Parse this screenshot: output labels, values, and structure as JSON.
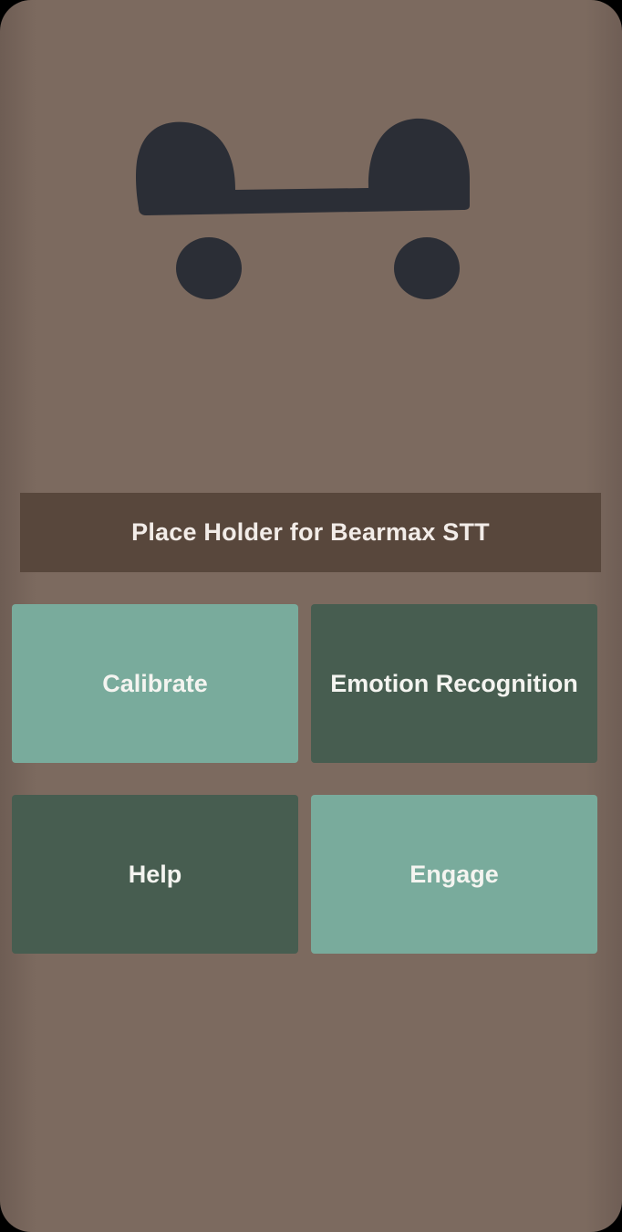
{
  "colors": {
    "background": "#7c6a5f",
    "face_features": "#2b2e36",
    "stt_bar": "#58473c",
    "button_light": "#79ab9c",
    "button_dark": "#475d50",
    "text": "#f4f4f0"
  },
  "face": {
    "eyebrows": "eyebrows-icon",
    "left_eye": "eye-icon",
    "right_eye": "eye-icon"
  },
  "stt": {
    "text": "Place Holder for Bearmax STT"
  },
  "buttons": {
    "calibrate": "Calibrate",
    "emotion_recognition": "Emotion Recognition",
    "help": "Help",
    "engage": "Engage"
  }
}
